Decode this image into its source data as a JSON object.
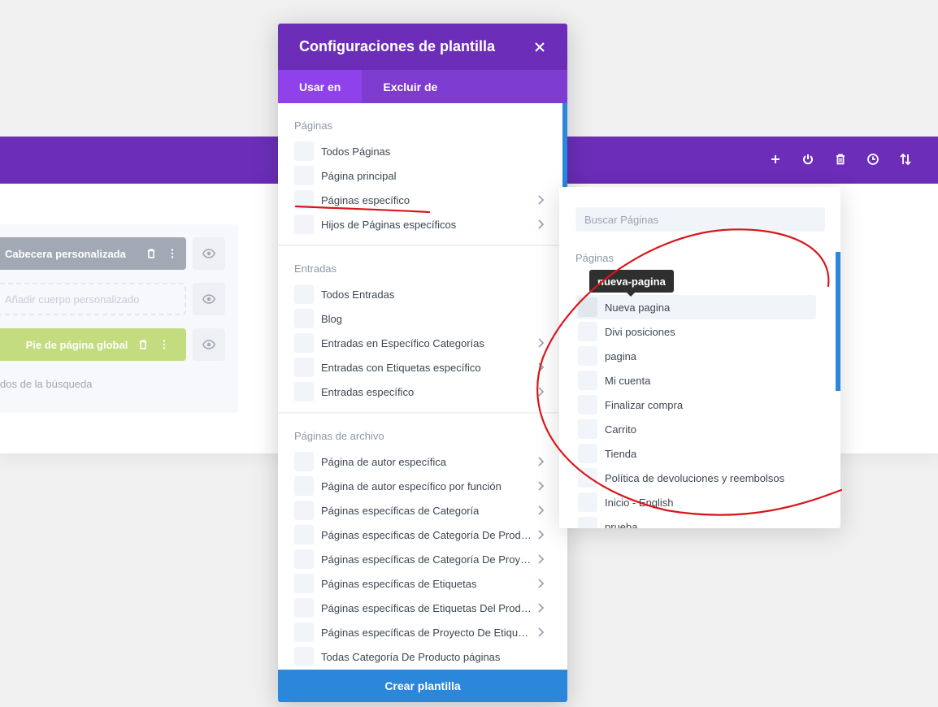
{
  "toolbar_icons": [
    "plus-icon",
    "power-icon",
    "trash-icon",
    "history-icon",
    "sort-icon"
  ],
  "layout": {
    "header_label": "Cabecera personalizada",
    "body_label": "Añadir cuerpo personalizado",
    "footer_label": "Pie de página global",
    "search_results_label": "dos de la búsqueda"
  },
  "modal": {
    "title": "Configuraciones de plantilla",
    "tabs": [
      {
        "label": "Usar en",
        "active": true
      },
      {
        "label": "Excluir de",
        "active": false
      }
    ],
    "sections": [
      {
        "title": "Páginas",
        "items": [
          {
            "label": "Todos Páginas",
            "chevron": false
          },
          {
            "label": "Página principal",
            "chevron": false
          },
          {
            "label": "Páginas específico",
            "chevron": true
          },
          {
            "label": "Hijos de Páginas específicos",
            "chevron": true
          }
        ]
      },
      {
        "title": "Entradas",
        "items": [
          {
            "label": "Todos Entradas",
            "chevron": false
          },
          {
            "label": "Blog",
            "chevron": false
          },
          {
            "label": "Entradas en Específico Categorías",
            "chevron": true
          },
          {
            "label": "Entradas con Etiquetas específico",
            "chevron": true
          },
          {
            "label": "Entradas específico",
            "chevron": true
          }
        ]
      },
      {
        "title": "Páginas de archivo",
        "items": [
          {
            "label": "Página de autor específica",
            "chevron": true
          },
          {
            "label": "Página de autor específico por función",
            "chevron": true
          },
          {
            "label": "Páginas específicas de Categoría",
            "chevron": true
          },
          {
            "label": "Páginas específicas de Categoría De Producto",
            "chevron": true
          },
          {
            "label": "Páginas específicas de Categoría De Proyecto",
            "chevron": true
          },
          {
            "label": "Páginas específicas de Etiquetas",
            "chevron": true
          },
          {
            "label": "Páginas específicas de Etiquetas Del Producto",
            "chevron": true
          },
          {
            "label": "Páginas específicas de Proyecto De Etiquetas",
            "chevron": true
          },
          {
            "label": "Todas Categoría De Producto páginas",
            "chevron": false
          }
        ]
      }
    ],
    "create_label": "Crear plantilla"
  },
  "flyout": {
    "search_placeholder": "Buscar Páginas",
    "section_title": "Páginas",
    "tooltip": "nueva-pagina",
    "items": [
      {
        "label": "Nueva pagina",
        "hover": true
      },
      {
        "label": "Divi posiciones",
        "hover": false
      },
      {
        "label": "pagina",
        "hover": false
      },
      {
        "label": "Mi cuenta",
        "hover": false
      },
      {
        "label": "Finalizar compra",
        "hover": false
      },
      {
        "label": "Carrito",
        "hover": false
      },
      {
        "label": "Tienda",
        "hover": false
      },
      {
        "label": "Política de devoluciones y reembolsos",
        "hover": false
      },
      {
        "label": "Inicio - English",
        "hover": false
      },
      {
        "label": "prueba",
        "hover": false
      }
    ]
  },
  "colors": {
    "purple_dark": "#6c2eb9",
    "purple_tab": "#7d3bcf",
    "purple_active": "#8f42ec",
    "blue": "#2b87da",
    "annotation_red": "#d9161c"
  }
}
